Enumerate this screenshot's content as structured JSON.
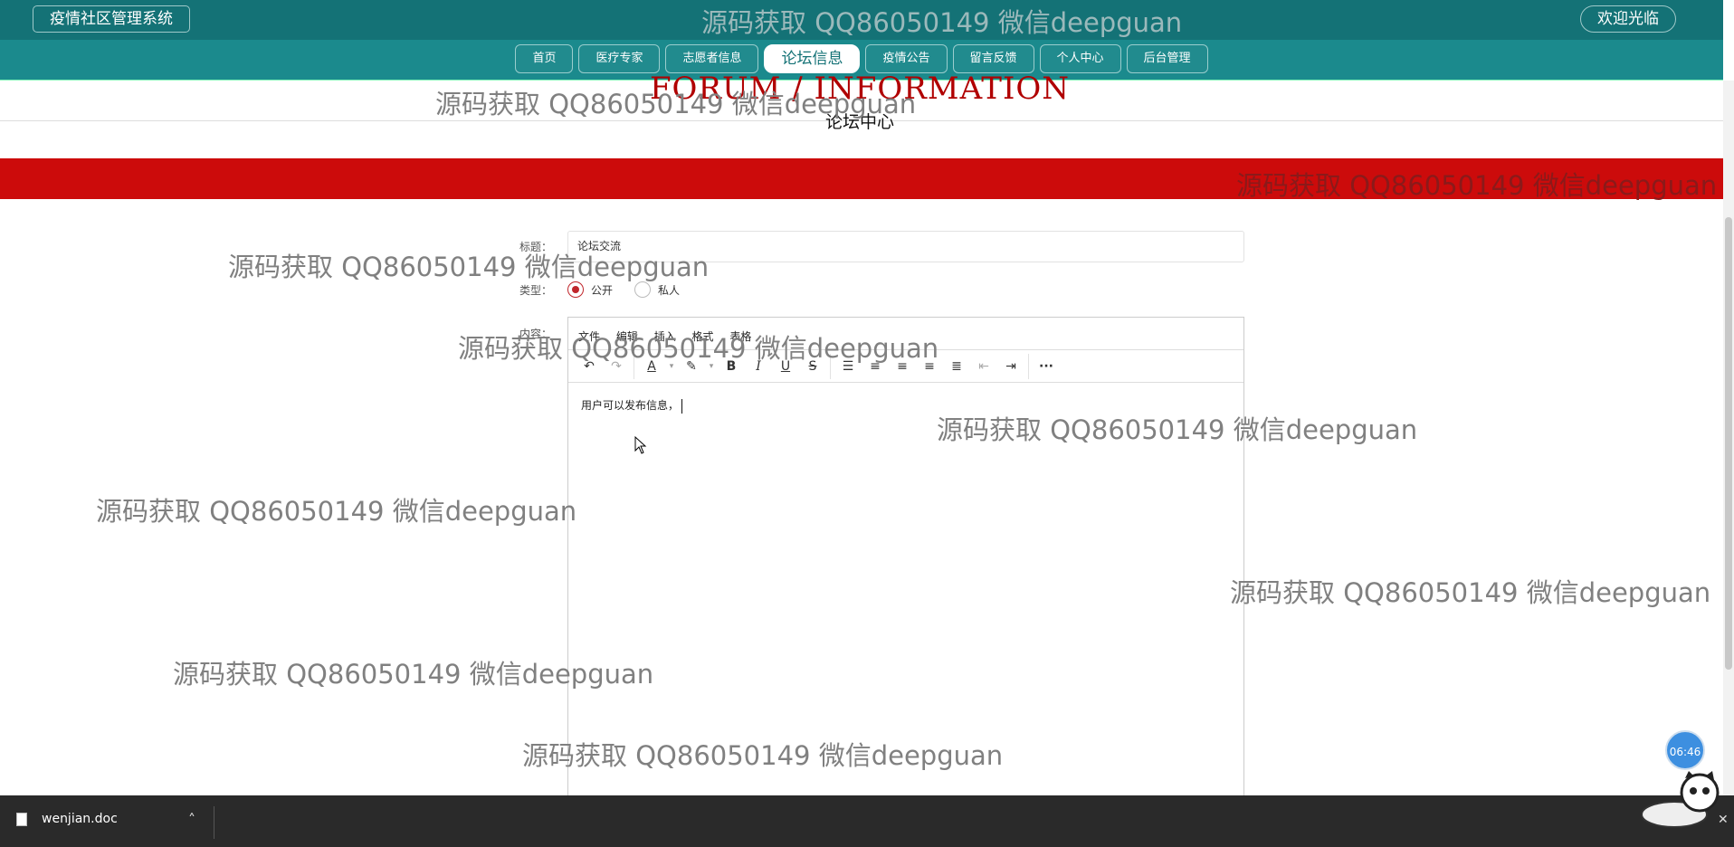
{
  "header": {
    "site_title": "疫情社区管理系统",
    "welcome": "欢迎光临"
  },
  "nav": [
    {
      "label": "首页"
    },
    {
      "label": "医疗专家"
    },
    {
      "label": "志愿者信息"
    },
    {
      "label": "论坛信息",
      "active": true
    },
    {
      "label": "疫情公告"
    },
    {
      "label": "留言反馈"
    },
    {
      "label": "个人中心"
    },
    {
      "label": "后台管理"
    }
  ],
  "section": {
    "title": "FORUM / INFORMATION",
    "subtitle": "论坛中心"
  },
  "form": {
    "title_label": "标题：",
    "title_value": "论坛交流",
    "type_label": "类型：",
    "type_options": [
      "公开",
      "私人"
    ],
    "type_selected": "公开",
    "content_label": "内容：",
    "editor_menu": [
      "文件",
      "编辑",
      "插入",
      "格式",
      "表格"
    ],
    "content_text": "用户可以发布信息，"
  },
  "watermark": "源码获取 QQ86050149 微信deepguan",
  "clock": "06:46",
  "taskbar": {
    "file_name": "wenjian.doc"
  },
  "colors": {
    "header": "#147276",
    "nav": "#1b8a8d",
    "band": "#cc0b0b",
    "title": "#b00000"
  }
}
